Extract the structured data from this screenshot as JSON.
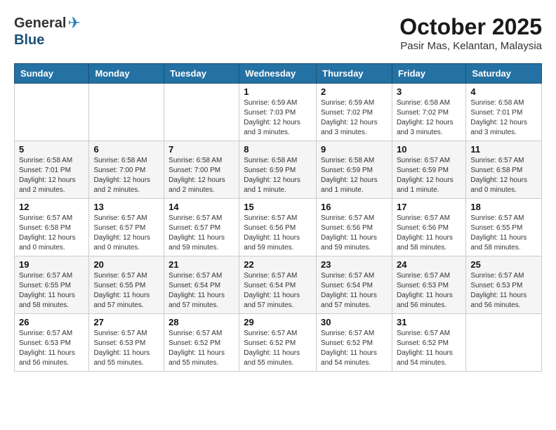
{
  "header": {
    "logo_general": "General",
    "logo_blue": "Blue",
    "month": "October 2025",
    "location": "Pasir Mas, Kelantan, Malaysia"
  },
  "days_of_week": [
    "Sunday",
    "Monday",
    "Tuesday",
    "Wednesday",
    "Thursday",
    "Friday",
    "Saturday"
  ],
  "weeks": [
    [
      {
        "day": "",
        "info": ""
      },
      {
        "day": "",
        "info": ""
      },
      {
        "day": "",
        "info": ""
      },
      {
        "day": "1",
        "info": "Sunrise: 6:59 AM\nSunset: 7:03 PM\nDaylight: 12 hours and 3 minutes."
      },
      {
        "day": "2",
        "info": "Sunrise: 6:59 AM\nSunset: 7:02 PM\nDaylight: 12 hours and 3 minutes."
      },
      {
        "day": "3",
        "info": "Sunrise: 6:58 AM\nSunset: 7:02 PM\nDaylight: 12 hours and 3 minutes."
      },
      {
        "day": "4",
        "info": "Sunrise: 6:58 AM\nSunset: 7:01 PM\nDaylight: 12 hours and 3 minutes."
      }
    ],
    [
      {
        "day": "5",
        "info": "Sunrise: 6:58 AM\nSunset: 7:01 PM\nDaylight: 12 hours and 2 minutes."
      },
      {
        "day": "6",
        "info": "Sunrise: 6:58 AM\nSunset: 7:00 PM\nDaylight: 12 hours and 2 minutes."
      },
      {
        "day": "7",
        "info": "Sunrise: 6:58 AM\nSunset: 7:00 PM\nDaylight: 12 hours and 2 minutes."
      },
      {
        "day": "8",
        "info": "Sunrise: 6:58 AM\nSunset: 6:59 PM\nDaylight: 12 hours and 1 minute."
      },
      {
        "day": "9",
        "info": "Sunrise: 6:58 AM\nSunset: 6:59 PM\nDaylight: 12 hours and 1 minute."
      },
      {
        "day": "10",
        "info": "Sunrise: 6:57 AM\nSunset: 6:59 PM\nDaylight: 12 hours and 1 minute."
      },
      {
        "day": "11",
        "info": "Sunrise: 6:57 AM\nSunset: 6:58 PM\nDaylight: 12 hours and 0 minutes."
      }
    ],
    [
      {
        "day": "12",
        "info": "Sunrise: 6:57 AM\nSunset: 6:58 PM\nDaylight: 12 hours and 0 minutes."
      },
      {
        "day": "13",
        "info": "Sunrise: 6:57 AM\nSunset: 6:57 PM\nDaylight: 12 hours and 0 minutes."
      },
      {
        "day": "14",
        "info": "Sunrise: 6:57 AM\nSunset: 6:57 PM\nDaylight: 11 hours and 59 minutes."
      },
      {
        "day": "15",
        "info": "Sunrise: 6:57 AM\nSunset: 6:56 PM\nDaylight: 11 hours and 59 minutes."
      },
      {
        "day": "16",
        "info": "Sunrise: 6:57 AM\nSunset: 6:56 PM\nDaylight: 11 hours and 59 minutes."
      },
      {
        "day": "17",
        "info": "Sunrise: 6:57 AM\nSunset: 6:56 PM\nDaylight: 11 hours and 58 minutes."
      },
      {
        "day": "18",
        "info": "Sunrise: 6:57 AM\nSunset: 6:55 PM\nDaylight: 11 hours and 58 minutes."
      }
    ],
    [
      {
        "day": "19",
        "info": "Sunrise: 6:57 AM\nSunset: 6:55 PM\nDaylight: 11 hours and 58 minutes."
      },
      {
        "day": "20",
        "info": "Sunrise: 6:57 AM\nSunset: 6:55 PM\nDaylight: 11 hours and 57 minutes."
      },
      {
        "day": "21",
        "info": "Sunrise: 6:57 AM\nSunset: 6:54 PM\nDaylight: 11 hours and 57 minutes."
      },
      {
        "day": "22",
        "info": "Sunrise: 6:57 AM\nSunset: 6:54 PM\nDaylight: 11 hours and 57 minutes."
      },
      {
        "day": "23",
        "info": "Sunrise: 6:57 AM\nSunset: 6:54 PM\nDaylight: 11 hours and 57 minutes."
      },
      {
        "day": "24",
        "info": "Sunrise: 6:57 AM\nSunset: 6:53 PM\nDaylight: 11 hours and 56 minutes."
      },
      {
        "day": "25",
        "info": "Sunrise: 6:57 AM\nSunset: 6:53 PM\nDaylight: 11 hours and 56 minutes."
      }
    ],
    [
      {
        "day": "26",
        "info": "Sunrise: 6:57 AM\nSunset: 6:53 PM\nDaylight: 11 hours and 56 minutes."
      },
      {
        "day": "27",
        "info": "Sunrise: 6:57 AM\nSunset: 6:53 PM\nDaylight: 11 hours and 55 minutes."
      },
      {
        "day": "28",
        "info": "Sunrise: 6:57 AM\nSunset: 6:52 PM\nDaylight: 11 hours and 55 minutes."
      },
      {
        "day": "29",
        "info": "Sunrise: 6:57 AM\nSunset: 6:52 PM\nDaylight: 11 hours and 55 minutes."
      },
      {
        "day": "30",
        "info": "Sunrise: 6:57 AM\nSunset: 6:52 PM\nDaylight: 11 hours and 54 minutes."
      },
      {
        "day": "31",
        "info": "Sunrise: 6:57 AM\nSunset: 6:52 PM\nDaylight: 11 hours and 54 minutes."
      },
      {
        "day": "",
        "info": ""
      }
    ]
  ]
}
